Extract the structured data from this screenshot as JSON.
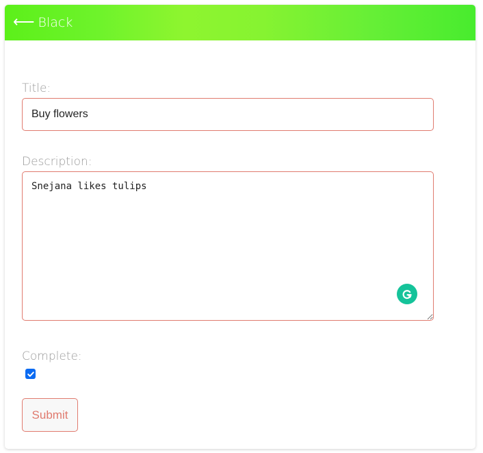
{
  "header": {
    "back_arrow": "⟵",
    "back_label": "Black",
    "gradient_colors": [
      "#5cf01a",
      "#8ef52f",
      "#48ec2e"
    ]
  },
  "form": {
    "title_label": "Title:",
    "title_value": "Buy flowers",
    "description_label": "Description:",
    "description_value": "Snejana likes tulips",
    "complete_label": "Complete:",
    "complete_checked": true,
    "submit_label": "Submit"
  },
  "icons": {
    "back": "arrow-left-icon",
    "grammarly": "grammarly-icon",
    "check": "checkmark-icon"
  },
  "colors": {
    "accent": "#e07a6e",
    "checkbox": "#0b6bf2",
    "grammarly": "#15c39a",
    "label": "#9a9a9a"
  }
}
